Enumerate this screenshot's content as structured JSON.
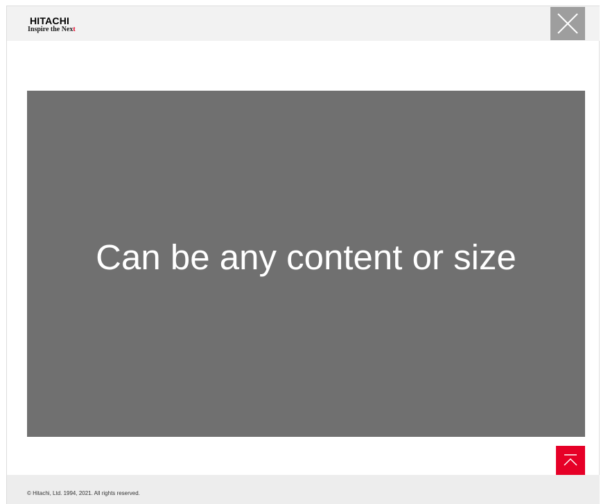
{
  "header": {
    "logo": {
      "brand": "HITACHI",
      "tagline_main": "Inspire the Nex",
      "tagline_accent": "t"
    },
    "close_icon": "close-x-icon"
  },
  "main": {
    "placeholder_text": "Can be any content or size"
  },
  "back_to_top_icon": "arrow-up-to-top-icon",
  "footer": {
    "copyright": "© Hitachi, Ltd. 1994, 2021. All rights reserved."
  },
  "colors": {
    "header_bg": "#f2f2f2",
    "close_button_bg": "#9e9e9e",
    "content_bg": "#707070",
    "back_to_top_bg": "#e60027",
    "footer_bg": "#ededed"
  }
}
